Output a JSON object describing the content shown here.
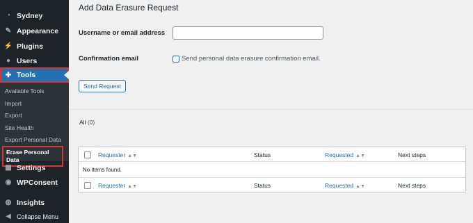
{
  "sidebar": {
    "items": [
      {
        "label": "Sydney",
        "icon": "gauge-icon"
      },
      {
        "label": "Appearance",
        "icon": "brush-icon"
      },
      {
        "label": "Plugins",
        "icon": "plug-icon"
      },
      {
        "label": "Users",
        "icon": "user-icon"
      },
      {
        "label": "Tools",
        "icon": "wrench-icon",
        "active": true
      },
      {
        "label": "Settings",
        "icon": "sliders-icon"
      },
      {
        "label": "WPConsent",
        "icon": "wpconsent-icon"
      },
      {
        "label": "Insights",
        "icon": "insights-icon"
      },
      {
        "label": "Collapse Menu",
        "icon": "collapse-icon"
      }
    ],
    "submenu": [
      "Available Tools",
      "Import",
      "Export",
      "Site Health",
      "Export Personal Data",
      "Erase Personal Data"
    ]
  },
  "main": {
    "title": "Add Data Erasure Request",
    "username_label": "Username or email address",
    "username_value": "",
    "confirmation_label": "Confirmation email",
    "confirmation_checkbox_label": "Send personal data erasure confirmation email.",
    "send_button": "Send Request",
    "filter_all": "All",
    "filter_count": "(0)",
    "table": {
      "columns": [
        "Requester",
        "Status",
        "Requested",
        "Next steps"
      ],
      "empty_message": "No items found."
    }
  },
  "colors": {
    "sidebar_bg": "#1d2327",
    "active_bg": "#2271b1",
    "highlight_border": "#d63638",
    "link": "#2271b1"
  }
}
